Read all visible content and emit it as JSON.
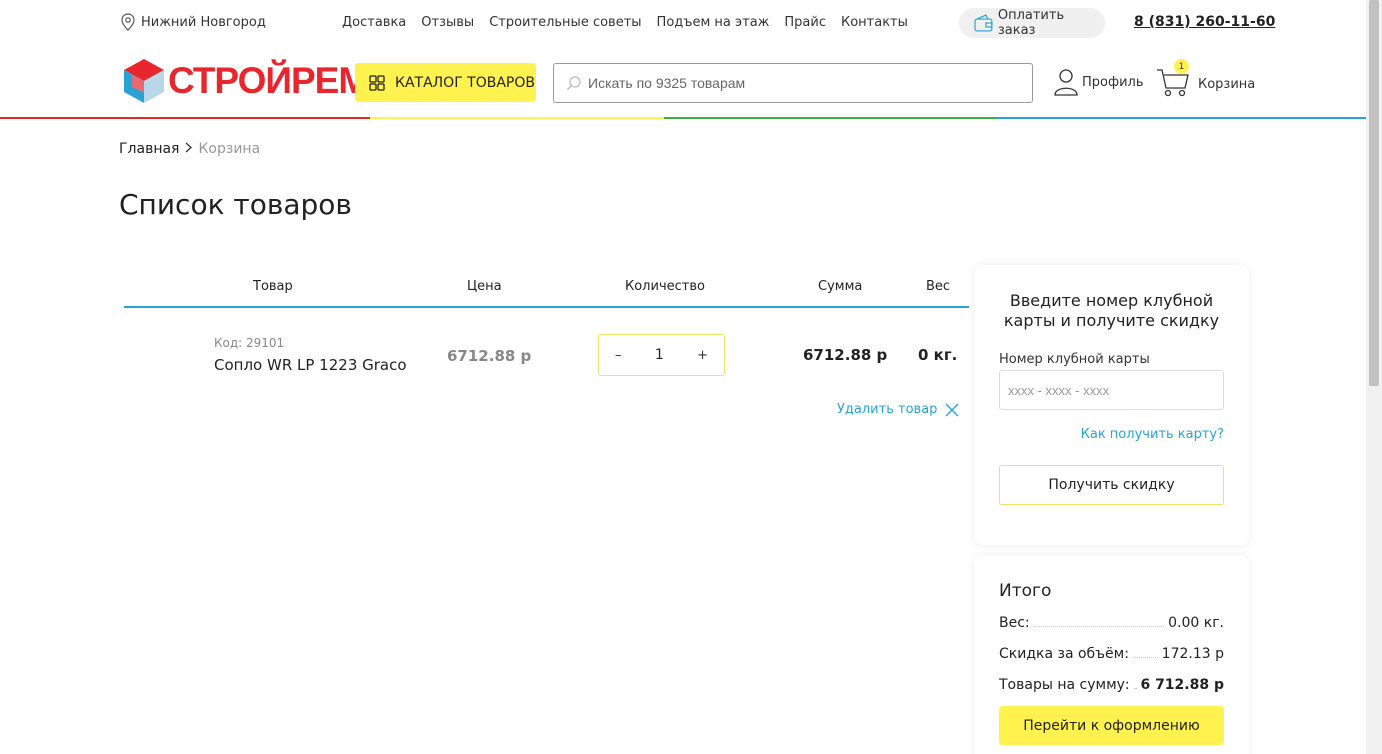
{
  "topbar": {
    "city": "Нижний Новгород",
    "nav": [
      "Доставка",
      "Отзывы",
      "Строительные советы",
      "Подъем на этаж",
      "Прайс",
      "Контакты"
    ],
    "pay_label": "Оплатить заказ",
    "phone": "8 (831) 260-11-60"
  },
  "header": {
    "logo_text": "СТРОЙРЕМ",
    "catalog_label": "КАТАЛОГ ТОВАРОВ",
    "search_placeholder": "Искать по 9325 товарам",
    "profile_label": "Профиль",
    "cart_label": "Корзина",
    "cart_count": "1"
  },
  "colors": {
    "accent_yellow": "#fff24e",
    "link_blue": "#29a3d6",
    "logo_red": "#e8262e",
    "rainbow": [
      "#e8262e",
      "#fff24e",
      "#3cb043",
      "#29a3d6"
    ]
  },
  "breadcrumb": {
    "home": "Главная",
    "current": "Корзина"
  },
  "page_title": "Список товаров",
  "table": {
    "headers": {
      "product": "Товар",
      "price": "Цена",
      "qty": "Количество",
      "sum": "Сумма",
      "weight": "Вес"
    },
    "item": {
      "code": "Код: 29101",
      "name": "Сопло WR LP 1223 Graco",
      "price": "6712.88 р",
      "qty_minus": "–",
      "qty": "1",
      "qty_plus": "+",
      "sum": "6712.88 р",
      "weight": "0 кг."
    },
    "delete_label": "Удалить товар"
  },
  "club": {
    "title": "Введите номер клубной карты и получите скидку",
    "label": "Номер клубной карты",
    "placeholder": "xxxx - xxxx - xxxx",
    "howto": "Как получить карту?",
    "button": "Получить скидку"
  },
  "total": {
    "title": "Итого",
    "weight_label": "Вес:",
    "weight_value": "0.00 кг.",
    "discount_label": "Скидка за объём:",
    "discount_value": "172.13 р",
    "goods_label": "Товары на сумму:",
    "goods_value": "6 712.88 р",
    "checkout": "Перейти к оформлению"
  }
}
